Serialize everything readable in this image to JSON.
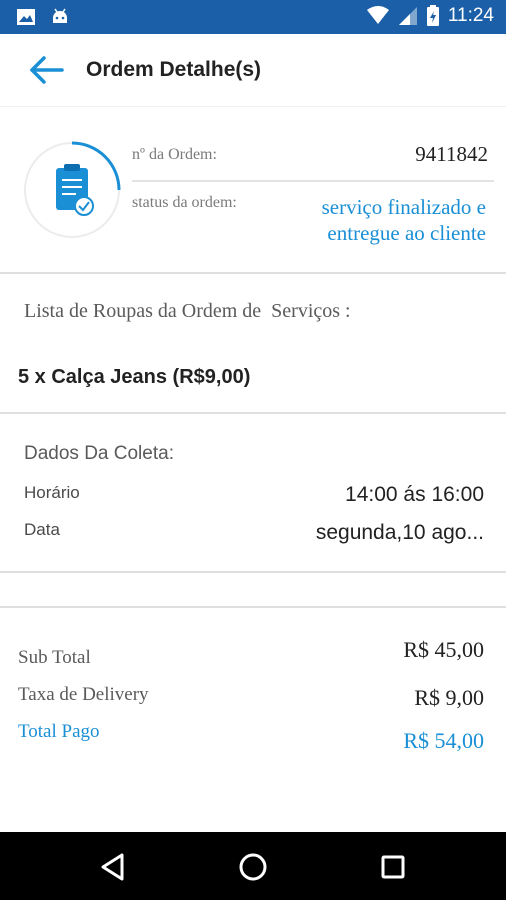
{
  "status_bar": {
    "time": "11:24",
    "left_icons": [
      "image-icon",
      "android-icon"
    ],
    "right_icons": [
      "wifi-icon",
      "signal-icon",
      "battery-icon"
    ]
  },
  "app_bar": {
    "title": "Ordem Detalhe(s)",
    "back_icon": "arrow-back-icon"
  },
  "order": {
    "number_label": "nº da Ordem:",
    "number": "9411842",
    "status_label": "status da ordem:",
    "status_line1": "serviço finalizado e",
    "status_line2": "entregue ao cliente",
    "icon": "clipboard-check-icon"
  },
  "clothes": {
    "title": "Lista de Roupas da Ordem de  Serviços :",
    "items": [
      "5 x Calça Jeans (R$9,00)"
    ]
  },
  "coleta": {
    "title": "Dados Da Coleta:",
    "rows": [
      {
        "label": "Horário",
        "value": "14:00 ás 16:00"
      },
      {
        "label": "Data",
        "value": "segunda,10 ago..."
      }
    ]
  },
  "totals": {
    "subtotal_label": "Sub Total",
    "subtotal_value": "R$ 45,00",
    "delivery_label": "Taxa de Delivery",
    "delivery_value": "R$ 9,00",
    "total_label": "Total Pago",
    "total_value": "R$ 54,00"
  },
  "colors": {
    "primary": "#1a5fa8",
    "accent": "#1a8fd6"
  },
  "nav": {
    "icons": [
      "back-triangle-icon",
      "home-circle-icon",
      "recents-square-icon"
    ]
  }
}
